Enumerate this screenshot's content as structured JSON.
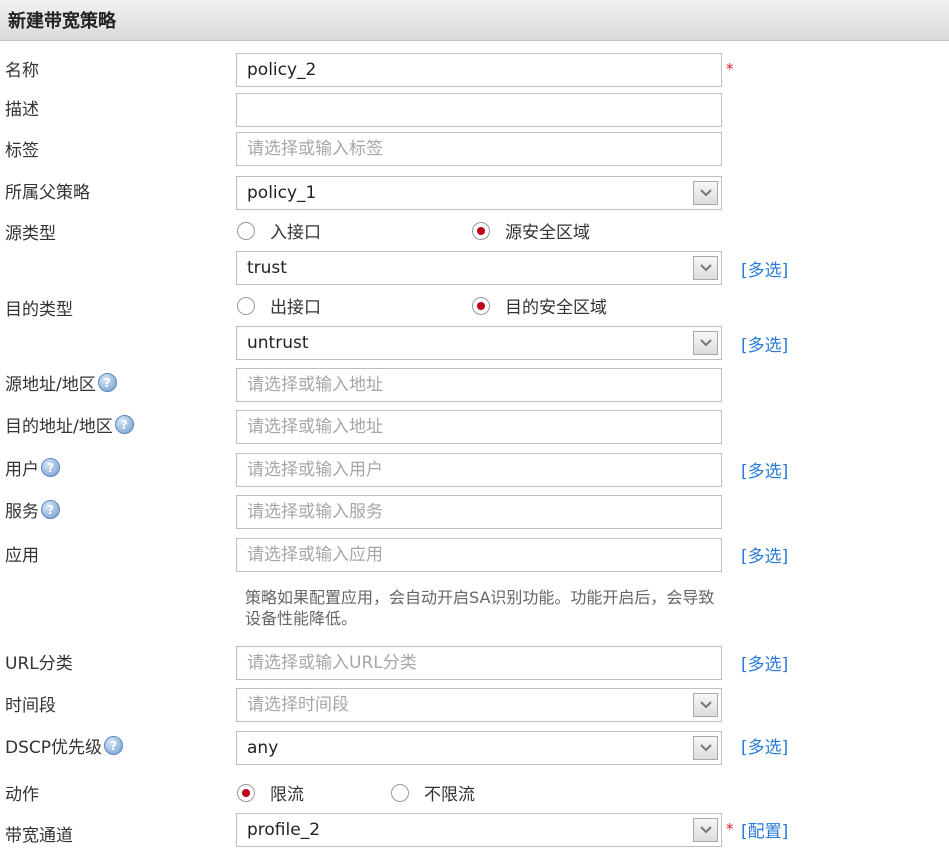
{
  "header": {
    "title": "新建带宽策略"
  },
  "labels": {
    "name": "名称",
    "description": "描述",
    "tag": "标签",
    "parent_policy": "所属父策略",
    "source_type": "源类型",
    "dest_type": "目的类型",
    "source_address": "源地址/地区",
    "dest_address": "目的地址/地区",
    "user": "用户",
    "service": "服务",
    "application": "应用",
    "url_category": "URL分类",
    "time_range": "时间段",
    "dscp": "DSCP优先级",
    "action": "动作",
    "bandwidth_channel": "带宽通道"
  },
  "fields": {
    "name_value": "policy_2",
    "description_value": "",
    "tag_placeholder": "请选择或输入标签",
    "parent_policy_value": "policy_1",
    "source_zone_value": "trust",
    "dest_zone_value": "untrust",
    "source_address_placeholder": "请选择或输入地址",
    "dest_address_placeholder": "请选择或输入地址",
    "user_placeholder": "请选择或输入用户",
    "service_placeholder": "请选择或输入服务",
    "application_placeholder": "请选择或输入应用",
    "url_category_placeholder": "请选择或输入URL分类",
    "time_range_placeholder": "请选择时间段",
    "dscp_value": "any",
    "bandwidth_channel_value": "profile_2"
  },
  "radios": {
    "source_interface": "入接口",
    "source_zone": "源安全区域",
    "dest_interface": "出接口",
    "dest_zone": "目的安全区域",
    "action_limit": "限流",
    "action_no_limit": "不限流",
    "selected_source": "源安全区域",
    "selected_dest": "目的安全区域",
    "selected_action": "限流"
  },
  "links": {
    "multi_select": "[多选]",
    "configure": "[配置]"
  },
  "help_symbol": "?",
  "required_mark": "*",
  "app_note": "策略如果配置应用，会自动开启SA识别功能。功能开启后，会导致设备性能降低。",
  "colors": {
    "link": "#2a7bd8",
    "required": "#e02020",
    "radio_selected": "#c0001a",
    "placeholder": "#a6a6a6"
  }
}
